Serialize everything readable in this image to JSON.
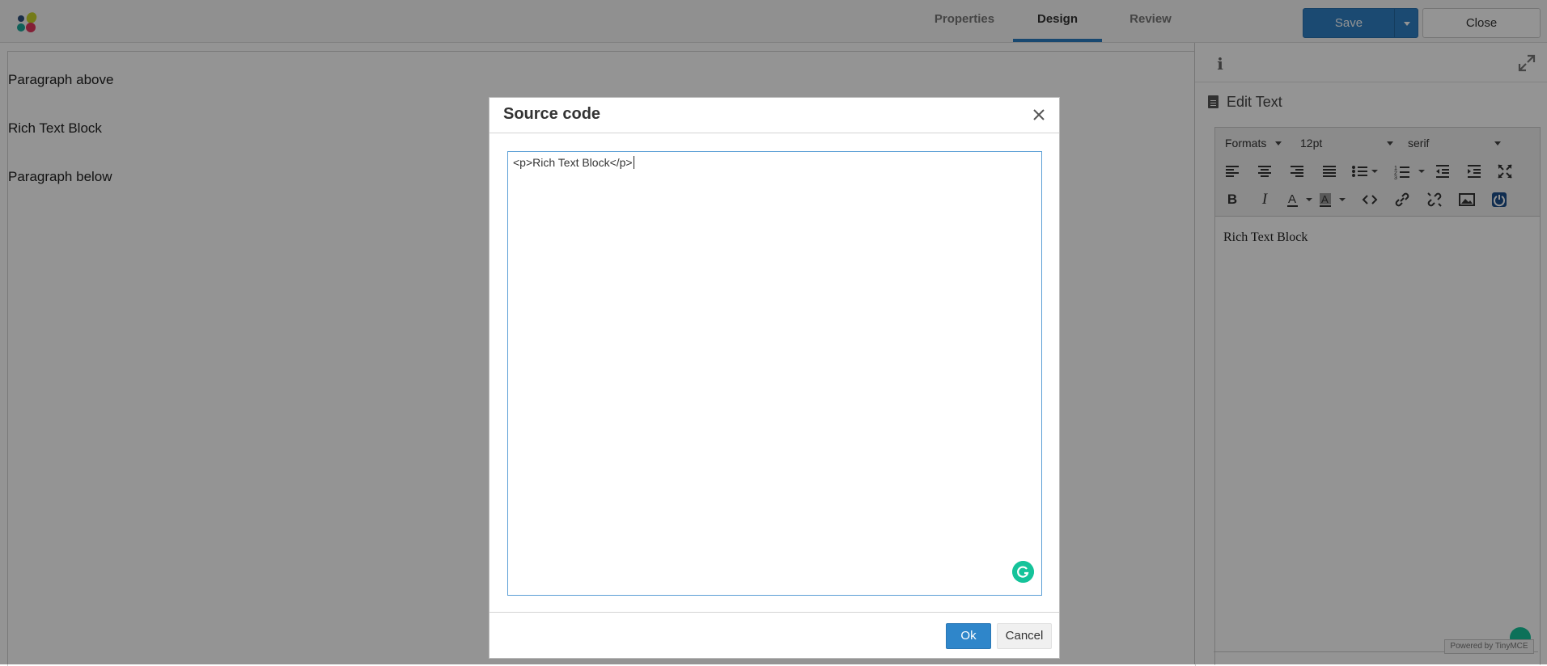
{
  "header": {
    "tabs": [
      {
        "label": "Properties",
        "active": false
      },
      {
        "label": "Design",
        "active": true
      },
      {
        "label": "Review",
        "active": false
      }
    ],
    "save_label": "Save",
    "close_label": "Close"
  },
  "canvas": {
    "paragraphs": [
      "Paragraph above",
      "Rich Text Block",
      "Paragraph below"
    ]
  },
  "panel": {
    "title": "Edit Text",
    "editor": {
      "formats_label": "Formats",
      "font_size": "12pt",
      "font_family": "serif",
      "content": "Rich Text Block",
      "powered_by": "Powered by TinyMCE",
      "toolbar_row1_icons": [
        "align-left-icon",
        "align-center-icon",
        "align-right-icon",
        "align-justify-icon",
        "bullet-list-icon",
        "numbered-list-icon",
        "outdent-icon",
        "indent-icon",
        "fullscreen-icon"
      ],
      "toolbar_row2_icons": [
        "bold-icon",
        "italic-icon",
        "text-color-icon",
        "background-color-icon",
        "source-code-icon",
        "link-icon",
        "unlink-icon",
        "image-icon",
        "power-icon"
      ]
    }
  },
  "dialog": {
    "title": "Source code",
    "source": "<p>Rich Text Block</p>",
    "ok_label": "Ok",
    "cancel_label": "Cancel"
  },
  "colors": {
    "accent": "#2f80c4",
    "grammarly": "#15c39a",
    "overlay": "rgba(0,0,0,0.42)"
  }
}
